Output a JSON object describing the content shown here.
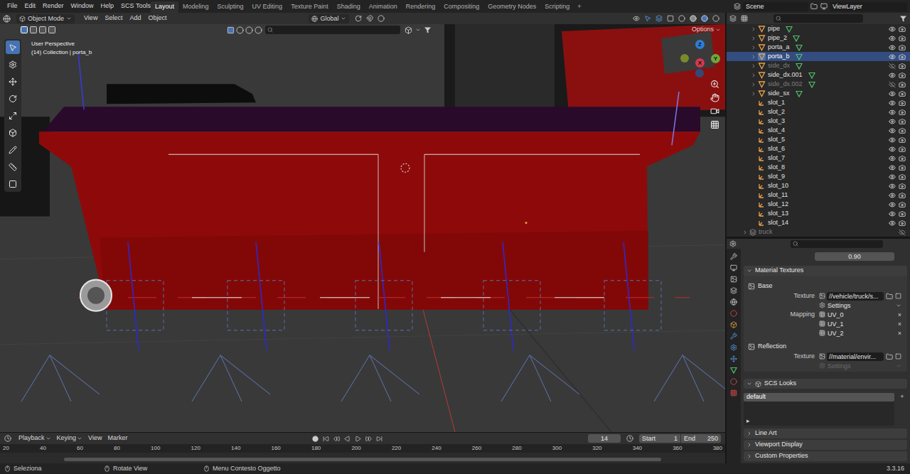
{
  "top_bar": {
    "menus": [
      "File",
      "Edit",
      "Render",
      "Window",
      "Help",
      "SCS Tools"
    ],
    "workspaces": [
      {
        "label": "Layout",
        "selected": true
      },
      {
        "label": "Modeling",
        "selected": false
      },
      {
        "label": "Sculpting",
        "selected": false
      },
      {
        "label": "UV Editing",
        "selected": false
      },
      {
        "label": "Texture Paint",
        "selected": false
      },
      {
        "label": "Shading",
        "selected": false
      },
      {
        "label": "Animation",
        "selected": false
      },
      {
        "label": "Rendering",
        "selected": false
      },
      {
        "label": "Compositing",
        "selected": false
      },
      {
        "label": "Geometry Nodes",
        "selected": false
      },
      {
        "label": "Scripting",
        "selected": false
      }
    ],
    "add_workspace": "+",
    "scene": "Scene",
    "view_layer": "ViewLayer"
  },
  "viewport_header": {
    "mode": "Object Mode",
    "menus": [
      "View",
      "Select",
      "Add",
      "Object"
    ],
    "orientation": "Global",
    "options": "Options"
  },
  "viewport": {
    "view_name": "User Perspective",
    "collection": "(14) Collection | porta_b",
    "axes": [
      {
        "label": "Z",
        "color": "#2e7dd7"
      },
      {
        "label": "Y",
        "color": "#6ea63a"
      },
      {
        "label": "X",
        "color": "#d23a4f"
      }
    ]
  },
  "outliner": {
    "children": [
      {
        "name": "pipe",
        "kind": "mesh",
        "expandable": true,
        "visible": true,
        "selected": false
      },
      {
        "name": "pipe_2",
        "kind": "mesh",
        "expandable": true,
        "visible": true,
        "selected": false
      },
      {
        "name": "porta_a",
        "kind": "mesh",
        "expandable": true,
        "visible": true,
        "selected": false
      },
      {
        "name": "porta_b",
        "kind": "mesh",
        "expandable": true,
        "visible": true,
        "selected": true
      },
      {
        "name": "side_dx",
        "kind": "mesh",
        "expandable": true,
        "visible": false,
        "selected": false
      },
      {
        "name": "side_dx.001",
        "kind": "mesh",
        "expandable": true,
        "visible": true,
        "selected": false
      },
      {
        "name": "side_dx.002",
        "kind": "mesh",
        "expandable": true,
        "visible": false,
        "selected": false
      },
      {
        "name": "side_sx",
        "kind": "mesh",
        "expandable": true,
        "visible": true,
        "selected": false
      },
      {
        "name": "slot_1",
        "kind": "empty",
        "expandable": false,
        "visible": true,
        "selected": false
      },
      {
        "name": "slot_2",
        "kind": "empty",
        "expandable": false,
        "visible": true,
        "selected": false
      },
      {
        "name": "slot_3",
        "kind": "empty",
        "expandable": false,
        "visible": true,
        "selected": false
      },
      {
        "name": "slot_4",
        "kind": "empty",
        "expandable": false,
        "visible": true,
        "selected": false
      },
      {
        "name": "slot_5",
        "kind": "empty",
        "expandable": false,
        "visible": true,
        "selected": false
      },
      {
        "name": "slot_6",
        "kind": "empty",
        "expandable": false,
        "visible": true,
        "selected": false
      },
      {
        "name": "slot_7",
        "kind": "empty",
        "expandable": false,
        "visible": true,
        "selected": false
      },
      {
        "name": "slot_8",
        "kind": "empty",
        "expandable": false,
        "visible": true,
        "selected": false
      },
      {
        "name": "slot_9",
        "kind": "empty",
        "expandable": false,
        "visible": true,
        "selected": false
      },
      {
        "name": "slot_10",
        "kind": "empty",
        "expandable": false,
        "visible": true,
        "selected": false
      },
      {
        "name": "slot_11",
        "kind": "empty",
        "expandable": false,
        "visible": true,
        "selected": false
      },
      {
        "name": "slot_12",
        "kind": "empty",
        "expandable": false,
        "visible": true,
        "selected": false
      },
      {
        "name": "slot_13",
        "kind": "empty",
        "expandable": false,
        "visible": true,
        "selected": false
      },
      {
        "name": "slot_14",
        "kind": "empty",
        "expandable": false,
        "visible": true,
        "selected": false
      }
    ],
    "sibling": {
      "name": "truck",
      "visible": false
    }
  },
  "properties": {
    "value": "0.90",
    "material_textures": {
      "title": "Material Textures",
      "slots": [
        {
          "name": "Base",
          "texture_label": "Texture",
          "texture": "//vehicle/truck/s...",
          "settings": "Settings",
          "settings_disabled": false,
          "mapping_label": "Mapping",
          "mappings": [
            "UV_0",
            "UV_1",
            "UV_2"
          ],
          "remove_glyph": "×"
        },
        {
          "name": "Reflection",
          "texture_label": "Texture",
          "texture": "//material/envir...",
          "settings": "Settings",
          "settings_disabled": true
        }
      ]
    },
    "scs_looks": {
      "title": "SCS Looks",
      "looks": [
        {
          "name": "default",
          "selected": true
        }
      ],
      "add": "+",
      "expand_glyph": "▸"
    },
    "collapsed_panels": [
      "Line Art",
      "Viewport Display",
      "Custom Properties"
    ]
  },
  "timeline": {
    "menus": [
      "Playback",
      "Keying",
      "View",
      "Marker"
    ],
    "current_frame": "14",
    "start_label": "Start",
    "start": "1",
    "end_label": "End",
    "end": "250",
    "ticks": [
      "20",
      "40",
      "60",
      "80",
      "100",
      "120",
      "140",
      "160",
      "180",
      "200",
      "220",
      "240",
      "260",
      "280",
      "300",
      "320",
      "340",
      "360",
      "380"
    ]
  },
  "status_bar": {
    "items": [
      "Seleziona",
      "Rotate View",
      "Menu Contesto Oggetto"
    ],
    "version": "3.3.16"
  }
}
